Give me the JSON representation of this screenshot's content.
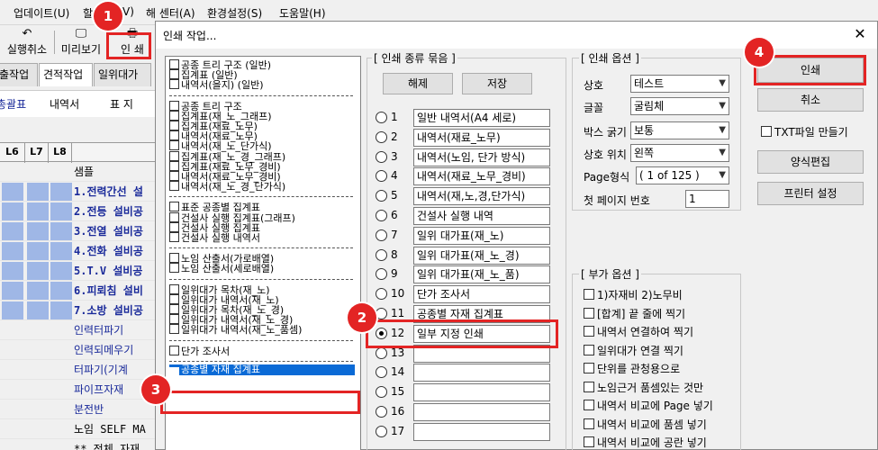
{
  "menubar": {
    "items": [
      "업데이트(U)",
      "할",
      "V)",
      "해 센터(A)",
      "환경설정(S)",
      "도움말(H)"
    ]
  },
  "toolbar": {
    "undo": "실행취소",
    "preview": "미리보기",
    "print": "인 쇄"
  },
  "tabs1": [
    "출작업",
    "견적작업",
    "일위대가"
  ],
  "tabs2": [
    "총괄표",
    "내역서",
    "표 지"
  ],
  "grid": {
    "headers": [
      "L6",
      "L7",
      "L8"
    ],
    "sample_label": "샘플",
    "rows": [
      {
        "text": "1.전력간선 설",
        "style": "bold"
      },
      {
        "text": "2.전등 설비공",
        "style": "bold"
      },
      {
        "text": "3.전열 설비공",
        "style": "bold"
      },
      {
        "text": "4.전화 설비공",
        "style": "bold"
      },
      {
        "text": "5.T.V 설비공",
        "style": "bold"
      },
      {
        "text": "6.피뢰침 설비",
        "style": "bold"
      },
      {
        "text": "7.소방 설비공",
        "style": "bold"
      },
      {
        "text": "인력터파기",
        "style": "link"
      },
      {
        "text": "인력되메우기",
        "style": "link"
      },
      {
        "text": "터파기(기계",
        "style": "link"
      },
      {
        "text": "파이프자재",
        "style": "link"
      },
      {
        "text": "분전반",
        "style": "link"
      },
      {
        "text": "노임 SELF MA",
        "style": "mono"
      },
      {
        "text": "** 전체 자재",
        "style": "mono"
      }
    ]
  },
  "dialog": {
    "title": "인쇄 작업...",
    "close": "✕",
    "left_list": [
      [
        "공종 트리 구조     (일반)",
        "집계표             (일반)",
        "내역서(을지)       (일반)"
      ],
      [
        "공종 트리 구조",
        "집계표(재_노_그래프)",
        "집계표(재료_노무)",
        "내역서(재료_노무)",
        "내역서(재_노_단가식)",
        "집계표(재_노_경_그래프)",
        "집계표(재료_노무_경비)",
        "내역서(재료_노무_경비)",
        "내역서(재_노_경_단가식)"
      ],
      [
        "표준 공종별 집계표",
        "건설사 실행 집계표(그래프)",
        "건설사 실행 집계표",
        "건설사 실행 내역서"
      ],
      [
        "노임 산출서(가로배열)",
        "노임 산출서(세로배열)"
      ],
      [
        "일위대가 목차(재_노)",
        "일위대가 내역서(재_노)",
        "일위대가 목차(재_노_경)",
        "일위대가 내역서(재_노_경)",
        "일위대가 내역서(재_노_품셈)"
      ],
      [
        "단가 조사서"
      ]
    ],
    "left_selected": "공종별 자재 집계표",
    "print_types": {
      "label": "[ 인쇄 종류 묶음 ]",
      "clear": "해제",
      "save": "저장",
      "items": [
        {
          "num": "1",
          "text": "일반 내역서(A4 세로)"
        },
        {
          "num": "2",
          "text": "내역서(재료_노무)"
        },
        {
          "num": "3",
          "text": "내역서(노임, 단가 방식)"
        },
        {
          "num": "4",
          "text": "내역서(재료_노무_경비)"
        },
        {
          "num": "5",
          "text": "내역서(재,노,경,단가식)"
        },
        {
          "num": "6",
          "text": "건설사 실행 내역"
        },
        {
          "num": "7",
          "text": "일위 대가표(재_노)"
        },
        {
          "num": "8",
          "text": "일위 대가표(재_노_경)"
        },
        {
          "num": "9",
          "text": "일위 대가표(재_노_품)"
        },
        {
          "num": "10",
          "text": "단가 조사서"
        },
        {
          "num": "11",
          "text": "공종별 자재 집계표"
        },
        {
          "num": "12",
          "text": "일부 지정 인쇄"
        },
        {
          "num": "13",
          "text": ""
        },
        {
          "num": "14",
          "text": ""
        },
        {
          "num": "15",
          "text": ""
        },
        {
          "num": "16",
          "text": ""
        },
        {
          "num": "17",
          "text": ""
        }
      ],
      "selected": "12"
    },
    "print_options": {
      "label": "[ 인쇄 옵션 ]",
      "company_label": "상호",
      "company_value": "테스트",
      "font_label": "글꼴",
      "font_value": "굴림체",
      "border_label": "박스 굵기",
      "border_value": "보통",
      "company_pos_label": "상호 위치",
      "company_pos_value": "왼쪽",
      "page_format_label": "Page형식",
      "page_format_value": "( 1 of 125 )",
      "first_page_label": "첫 페이지 번호",
      "first_page_value": "1"
    },
    "extra_options": {
      "label": "[ 부가 옵션 ]",
      "items": [
        "1)자재비   2)노무비",
        "[합계] 끝 줄에 찍기",
        "내역서 연결하여 찍기",
        "일위대가 연결 찍기",
        "단위를 관청용으로",
        "노임근거 품셈있는 것만",
        "내역서 비교에 Page 넣기",
        "내역서 비교에 품셈 넣기",
        "내역서 비교에 공란 넣기"
      ]
    },
    "buttons": {
      "print": "인쇄",
      "cancel": "취소",
      "txt": "TXT파일 만들기",
      "form_edit": "양식편집",
      "printer_setup": "프린터 설정"
    }
  },
  "markers": [
    "1",
    "2",
    "3",
    "4"
  ]
}
